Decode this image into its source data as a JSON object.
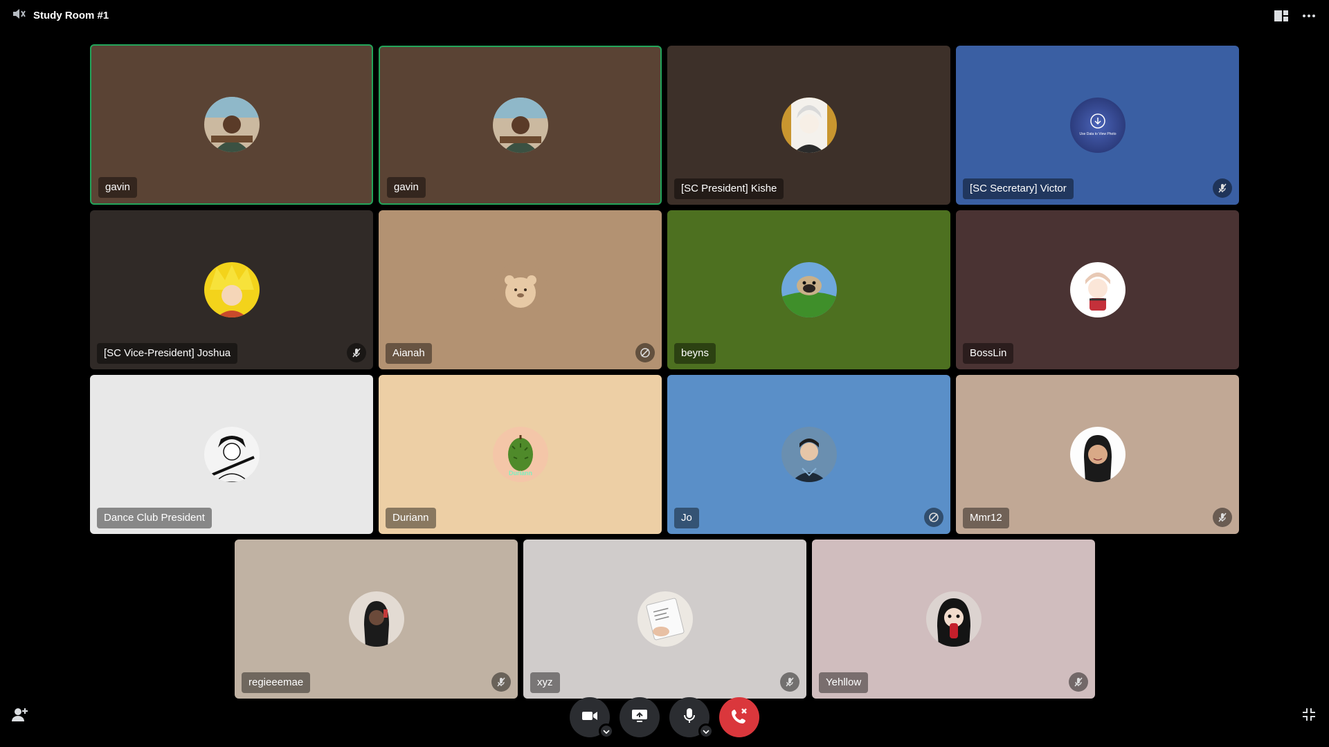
{
  "room": {
    "title": "Study Room #1",
    "icon": "speaker-icon"
  },
  "toolbar": {
    "grid_icon": "grid-layout-icon",
    "more_icon": "more-options-icon"
  },
  "participants": [
    {
      "name": "gavin",
      "bg": "#5a4334",
      "speaking": true,
      "status": ""
    },
    {
      "name": "gavin",
      "bg": "#5a4334",
      "speaking": true,
      "status": ""
    },
    {
      "name": "[SC President] Kishe",
      "bg": "#3d3029",
      "speaking": false,
      "status": ""
    },
    {
      "name": "[SC Secretary] Victor",
      "bg": "#3a5fa3",
      "speaking": false,
      "status": "muted-icon",
      "avatar_text": "Use Data to View Photo"
    },
    {
      "name": "[SC Vice-President] Joshua",
      "bg": "#302a27",
      "speaking": false,
      "status": "muted-icon"
    },
    {
      "name": "Aianah",
      "bg": "#b39272",
      "speaking": false,
      "status": "camera-off-icon"
    },
    {
      "name": "beyns",
      "bg": "#4d7020",
      "speaking": false,
      "status": ""
    },
    {
      "name": "BossLin",
      "bg": "#4a3333",
      "speaking": false,
      "status": ""
    },
    {
      "name": "Dance Club President",
      "bg": "#e8e8e8",
      "speaking": false,
      "status": ""
    },
    {
      "name": "Duriann",
      "bg": "#edcfa5",
      "speaking": false,
      "status": "",
      "avatar_text": "Duriann"
    },
    {
      "name": "Jo",
      "bg": "#5a8fc8",
      "speaking": false,
      "status": "camera-off-icon"
    },
    {
      "name": "Mmr12",
      "bg": "#c1a895",
      "speaking": false,
      "status": "muted-icon"
    },
    {
      "name": "regieeemae",
      "bg": "#c0b2a3",
      "speaking": false,
      "status": "muted-icon"
    },
    {
      "name": "xyz",
      "bg": "#d0cccb",
      "speaking": false,
      "status": "muted-icon"
    },
    {
      "name": "Yehllow",
      "bg": "#d0bdbe",
      "speaking": false,
      "status": "muted-icon"
    }
  ],
  "controls": {
    "camera_icon": "video-camera-icon",
    "screen_share_icon": "screen-share-icon",
    "mic_icon": "microphone-icon",
    "disconnect_icon": "disconnect-call-icon",
    "invite_icon": "add-user-icon",
    "fullscreen_icon": "exit-fullscreen-icon"
  },
  "colors": {
    "accent_speaking": "#23a55a",
    "end_call": "#da373c",
    "button_bg": "#2b2d31"
  }
}
